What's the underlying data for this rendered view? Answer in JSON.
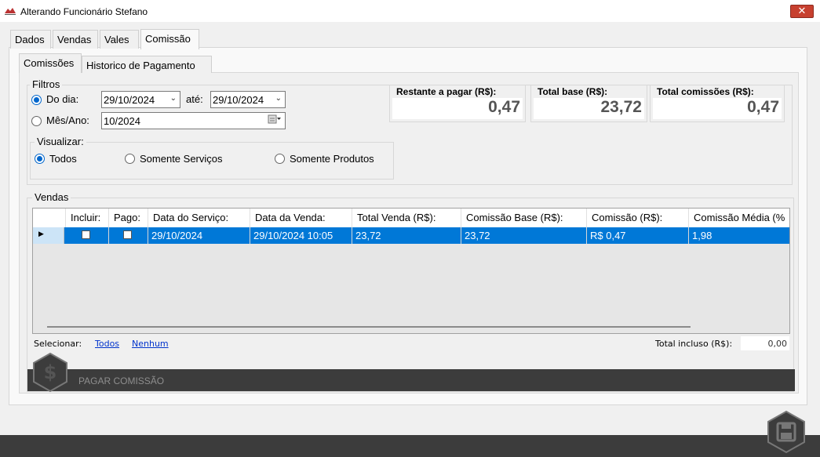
{
  "window": {
    "title": "Alterando Funcionário Stefano",
    "close_glyph": "✕"
  },
  "tabs": [
    "Dados",
    "Vendas",
    "Vales",
    "Comissão"
  ],
  "inner_tabs": [
    "Comissões",
    "Historico de Pagamento"
  ],
  "filters": {
    "legend": "Filtros",
    "do_dia_label": "Do dia:",
    "date_from": "29/10/2024",
    "ate_label": "até:",
    "date_to": "29/10/2024",
    "mes_ano_label": "Mês/Ano:",
    "mes_ano_value": "10/2024"
  },
  "visualizar": {
    "legend": "Visualizar:",
    "options": [
      "Todos",
      "Somente Serviços",
      "Somente Produtos"
    ],
    "selected": "Todos"
  },
  "totals": {
    "restante_label": "Restante a pagar (R$):",
    "restante_value": "0,47",
    "base_label": "Total base (R$):",
    "base_value": "23,72",
    "comissoes_label": "Total comissões (R$):",
    "comissoes_value": "0,47"
  },
  "vendas": {
    "legend": "Vendas",
    "columns": [
      "Incluir:",
      "Pago:",
      "Data do Serviço:",
      "Data da Venda:",
      "Total Venda (R$):",
      "Comissão Base (R$):",
      "Comissão (R$):",
      "Comissão Média (%"
    ],
    "rows": [
      {
        "data_servico": "29/10/2024",
        "data_venda": "29/10/2024 10:05",
        "total_venda": "23,72",
        "comissao_base": "23,72",
        "comissao": "R$ 0,47",
        "comissao_media": "1,98"
      }
    ]
  },
  "selection": {
    "label": "Selecionar:",
    "todos": "Todos",
    "nenhum": "Nenhum",
    "total_incluso_label": "Total incluso (R$):",
    "total_incluso_value": "0,00"
  },
  "pagar_comissao_label": "PAGAR COMISSÃO",
  "icons": {
    "pay": "dollar-icon",
    "save": "save-icon"
  },
  "colors": {
    "selection": "#0078d7",
    "dark_bar": "#3c3c3c",
    "close": "#c7402f"
  }
}
